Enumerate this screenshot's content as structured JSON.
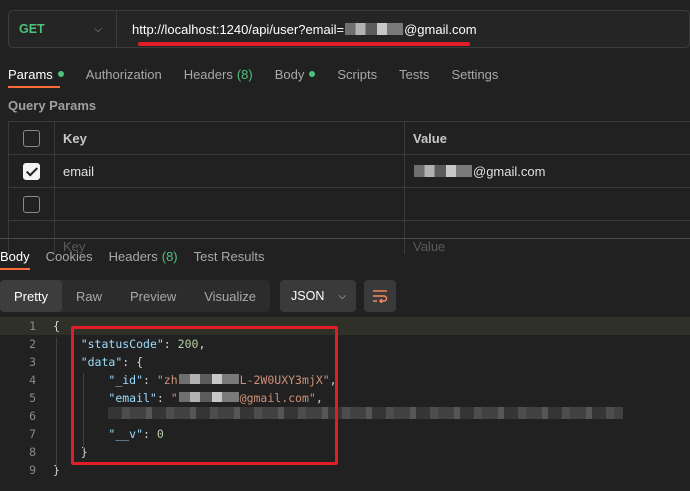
{
  "request": {
    "method": "GET",
    "url_prefix": "http://localhost:1240/api/user?email=",
    "url_suffix": "@gmail.com"
  },
  "request_tabs": [
    {
      "label": "Params",
      "dot": true
    },
    {
      "label": "Authorization"
    },
    {
      "label": "Headers",
      "count": "(8)"
    },
    {
      "label": "Body",
      "dot": true
    },
    {
      "label": "Scripts"
    },
    {
      "label": "Tests"
    },
    {
      "label": "Settings"
    }
  ],
  "query_params": {
    "title": "Query Params",
    "key_header": "Key",
    "value_header": "Value",
    "row_key": "email",
    "row_value_suffix": "@gmail.com",
    "key_placeholder": "Key",
    "value_placeholder": "Value"
  },
  "response_tabs": [
    {
      "label": "Body"
    },
    {
      "label": "Cookies"
    },
    {
      "label": "Headers",
      "count": "(8)"
    },
    {
      "label": "Test Results"
    }
  ],
  "view_modes": [
    "Pretty",
    "Raw",
    "Preview",
    "Visualize"
  ],
  "format": "JSON",
  "response_body": {
    "line_numbers": [
      "1",
      "2",
      "3",
      "4",
      "5",
      "6",
      "7",
      "8",
      "9"
    ],
    "status_key": "\"statusCode\"",
    "status_value": "200",
    "data_key": "\"data\"",
    "id_key": "\"_id\"",
    "id_value_start": "\"zh",
    "id_value_end": "L-2W0UXY3mjX\"",
    "email_key": "\"email\"",
    "email_value_end": "@gmail.com\"",
    "v_key": "\"__v\"",
    "v_value": "0"
  },
  "colors": {
    "accent": "#ff6c37",
    "method": "#4ec27a",
    "annotation": "#e11d2a"
  }
}
